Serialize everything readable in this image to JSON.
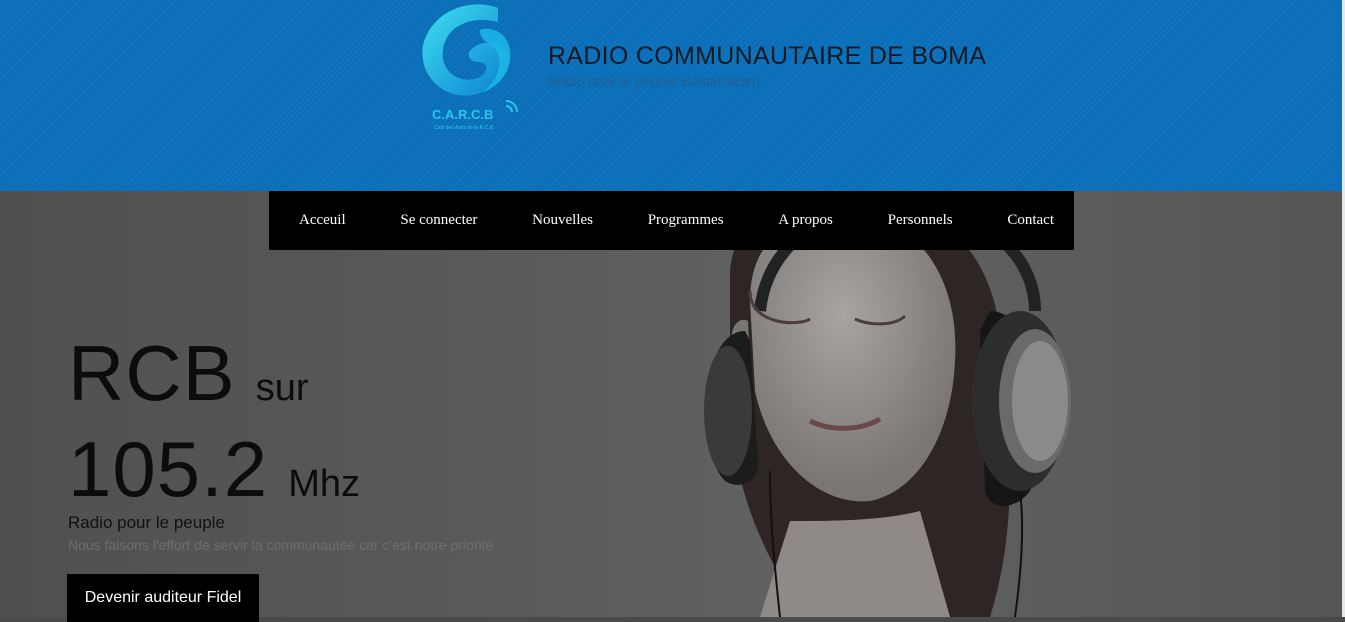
{
  "header": {
    "title": "RADIO COMMUNAUTAIRE DE BOMA",
    "tagline": "Radio pour le peuple Bomatracien",
    "logo_text": "C.A.R.C.B",
    "logo_subtext": "Club des Amis de la R.C.B",
    "background_color": "#0a6fb8"
  },
  "nav": {
    "items": [
      "Acceuil",
      "Se connecter",
      "Nouvelles",
      "Programmes",
      "A propos",
      "Personnels",
      "Contact"
    ]
  },
  "hero": {
    "station": "RCB",
    "on_word": "sur",
    "frequency": "105.2",
    "unit": "Mhz",
    "subtitle": "Radio pour le peuple",
    "description": "Nous faisons l'effort de servir la communautée car c'est notre priorité",
    "cta_label": "Devenir auditeur Fidel"
  }
}
